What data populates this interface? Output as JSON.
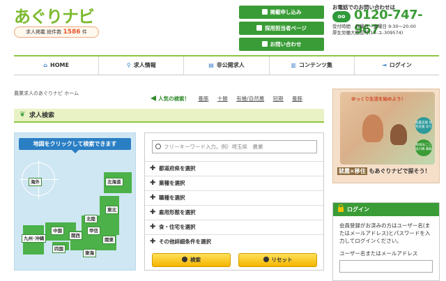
{
  "header": {
    "logo_text": "あぐりナビ",
    "job_count_label": "求人掲載 総件数",
    "job_count": "1586",
    "job_count_unit": "件",
    "buttons": [
      {
        "label": "掲載申し込み"
      },
      {
        "label": "採用担当者ページ"
      },
      {
        "label": "お問い合わせ"
      }
    ],
    "phone_title": "お電話でのお問い合わせは",
    "free_dial_mark": "oo",
    "phone_number": "0120-747-967",
    "hours_line1": "受付時間　月曜日～金曜日 9:30～20:00",
    "hours_line2": "厚生労働大臣認可(13-ユ-309574)"
  },
  "nav": {
    "items": [
      {
        "label": "HOME",
        "icon": "home-icon"
      },
      {
        "label": "求人情報",
        "icon": "search-icon"
      },
      {
        "label": "非公開求人",
        "icon": "document-icon"
      },
      {
        "label": "コンテンツ集",
        "icon": "book-icon"
      },
      {
        "label": "ログイン",
        "icon": "login-icon"
      }
    ]
  },
  "breadcrumb": "農業求人のあぐりナビ ホーム",
  "popular": {
    "label": "人気の検索！",
    "tags": [
      "養豚",
      "十勝",
      "有機/自然農",
      "短期",
      "養豚"
    ]
  },
  "section_title": "求人検索",
  "map": {
    "title": "地図をクリックして検索できます",
    "regions": {
      "overseas": "海外",
      "hokkaido": "北海道",
      "tohoku": "東北",
      "hokuriku": "北陸",
      "chugoku": "中国",
      "kansai": "関西",
      "koshinetsu": "甲信",
      "kanto": "関東",
      "kyushu": "九州･沖縄",
      "shikoku": "四国",
      "tokai": "東海"
    }
  },
  "search": {
    "keyword_placeholder": "フリーキーワード入力。例）埼玉県　農業",
    "conditions": [
      "都道府県を選択",
      "業種を選択",
      "職種を選択",
      "雇用形態を選択",
      "食・住宅を選択",
      "その他詳細条件を選択"
    ],
    "search_button": "検索",
    "reset_button": "リセット"
  },
  "banner": {
    "head_text": "ゆっくり生活を始めよう！",
    "badge1": "就農支援 住宅支援 あり",
    "badge2": "地域おこし 協力隊 募集",
    "caption_box": "就農×移住",
    "caption_text": "もあぐりナビで探そう！"
  },
  "login": {
    "title": "ログイン",
    "description": "会員登録がお済みの方はユーザー名(またはメールアドレス)とパスワードを入力してログインください。",
    "username_label": "ユーザー名またはメールアドレス"
  },
  "colors": {
    "brand_green": "#3a9c36",
    "logo_green": "#7cba2f",
    "map_blue": "#2a7fc4",
    "button_yellow": "#f4b400"
  }
}
